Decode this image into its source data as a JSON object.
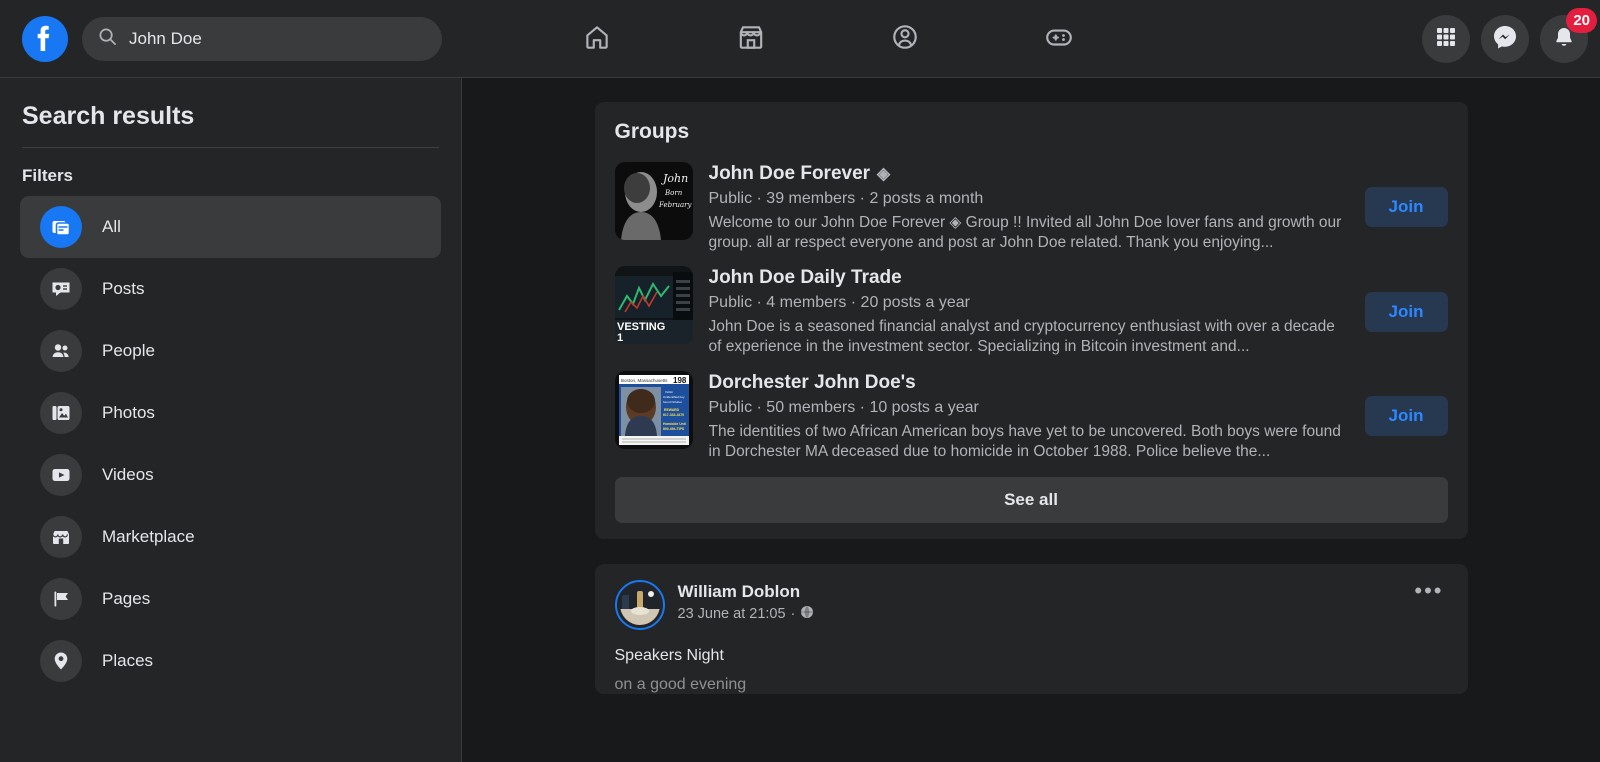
{
  "topbar": {
    "logo": "facebook-logo",
    "search": {
      "value": "John Doe",
      "placeholder": "Search Facebook",
      "icon": "search-icon"
    },
    "nav": [
      {
        "name": "home",
        "icon": "home-icon"
      },
      {
        "name": "marketplace",
        "icon": "marketplace-icon"
      },
      {
        "name": "groups",
        "icon": "groups-icon"
      },
      {
        "name": "gaming",
        "icon": "gaming-icon"
      }
    ],
    "actions": [
      {
        "name": "menu",
        "icon": "grid-menu-icon"
      },
      {
        "name": "messenger",
        "icon": "messenger-icon"
      },
      {
        "name": "notifications",
        "icon": "bell-icon",
        "badge": "20"
      }
    ]
  },
  "sidebar": {
    "title": "Search results",
    "filters_label": "Filters",
    "items": [
      {
        "label": "All",
        "icon": "all-results-icon",
        "active": true
      },
      {
        "label": "Posts",
        "icon": "posts-icon",
        "active": false
      },
      {
        "label": "People",
        "icon": "people-icon",
        "active": false
      },
      {
        "label": "Photos",
        "icon": "photos-icon",
        "active": false
      },
      {
        "label": "Videos",
        "icon": "videos-icon",
        "active": false
      },
      {
        "label": "Marketplace",
        "icon": "marketplace-icon",
        "active": false
      },
      {
        "label": "Pages",
        "icon": "pages-icon",
        "active": false
      },
      {
        "label": "Places",
        "icon": "places-icon",
        "active": false
      }
    ]
  },
  "groups_card": {
    "title": "Groups",
    "see_all_label": "See all",
    "join_label": "Join",
    "groups": [
      {
        "name": "John Doe Forever",
        "verified_glyph": "◈",
        "meta": "Public · 39 members · 2 posts a month",
        "description": "Welcome to our John Doe Forever ◈ Group !! Invited all John Doe lover fans and growth our group. all ar respect everyone and post ar John Doe related. Thank you enjoying...",
        "join_label": "Join",
        "thumb": "portrait-bw-photo"
      },
      {
        "name": "John Doe Daily Trade",
        "verified_glyph": "",
        "meta": "Public · 4 members · 20 posts a year",
        "description": "John Doe is a seasoned financial analyst and cryptocurrency enthusiast with over a decade of experience in the investment sector. Specializing in Bitcoin investment and...",
        "join_label": "Join",
        "thumb": "trading-chart-photo"
      },
      {
        "name": "Dorchester John Doe's",
        "verified_glyph": "",
        "meta": "Public · 50 members · 10 posts a year",
        "description": "The identities of two African American boys have yet to be uncovered. Both boys were found in Dorchester MA deceased due to homicide in October 1988. Police believe the...",
        "join_label": "Join",
        "thumb": "missing-person-flyer-photo"
      }
    ]
  },
  "post": {
    "author": "William Doblon",
    "timestamp": "23 June at 21:05",
    "privacy_icon": "globe-icon",
    "separator": "·",
    "menu_glyph": "•••",
    "text": "Speakers Night",
    "text_partial": "on a good evening"
  }
}
